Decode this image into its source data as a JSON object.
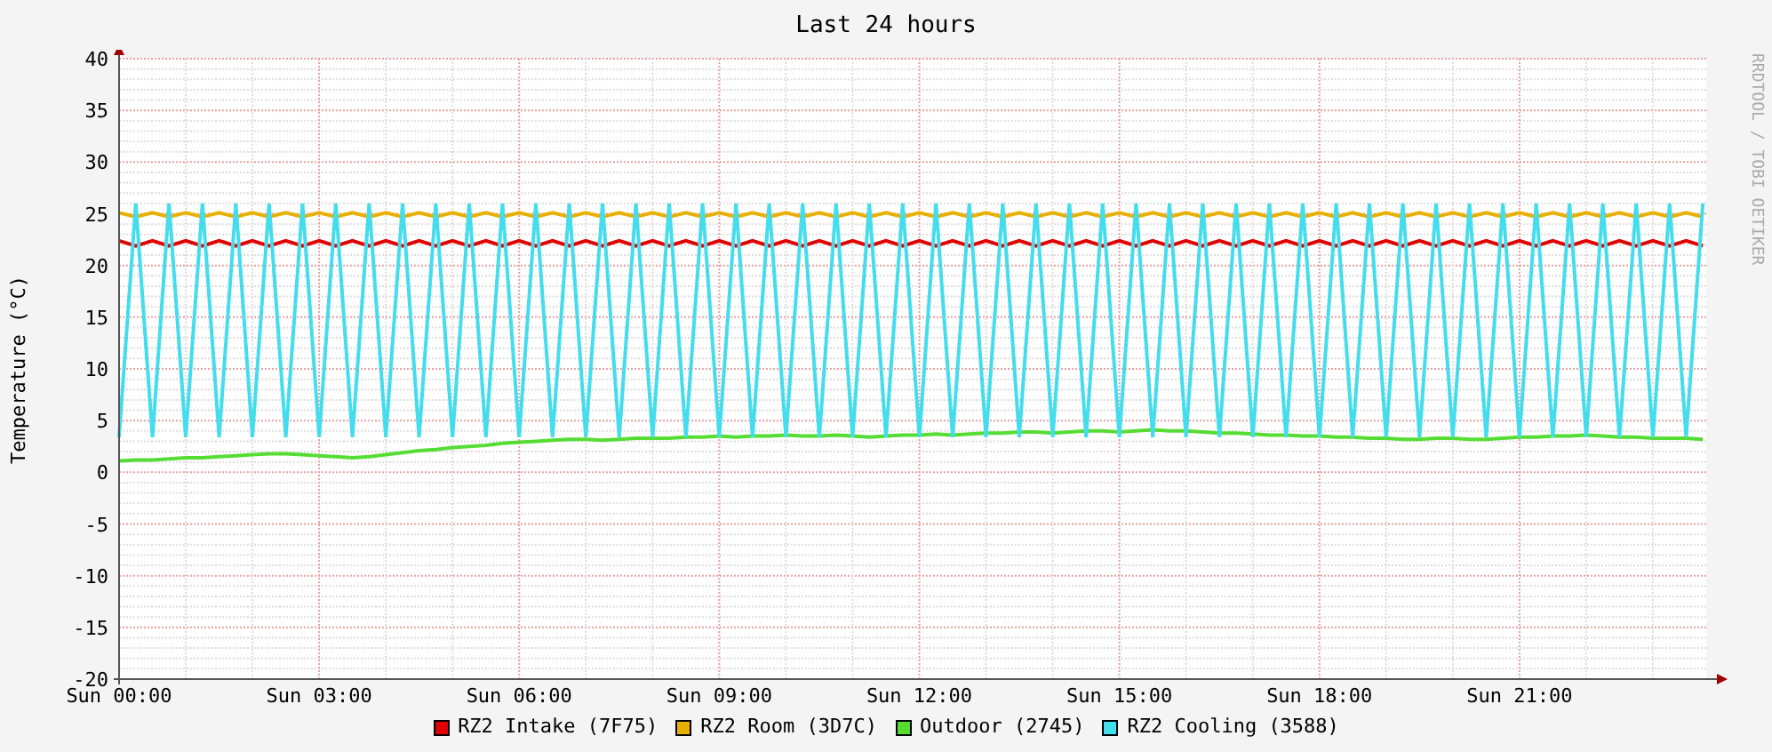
{
  "chart": {
    "chart_data": {
      "type": "line",
      "title": "Last 24 hours",
      "ylabel": "Temperature (°C)",
      "ylim": [
        -20,
        40
      ],
      "grid": true,
      "categories": [
        "Sun 00:00",
        null,
        null,
        null,
        null,
        null,
        null,
        null,
        null,
        null,
        null,
        null,
        "Sun 03:00",
        null,
        null,
        null,
        null,
        null,
        null,
        null,
        null,
        null,
        null,
        null,
        "Sun 06:00",
        null,
        null,
        null,
        null,
        null,
        null,
        null,
        null,
        null,
        null,
        null,
        "Sun 09:00",
        null,
        null,
        null,
        null,
        null,
        null,
        null,
        null,
        null,
        null,
        null,
        "Sun 12:00",
        null,
        null,
        null,
        null,
        null,
        null,
        null,
        null,
        null,
        null,
        null,
        "Sun 15:00",
        null,
        null,
        null,
        null,
        null,
        null,
        null,
        null,
        null,
        null,
        null,
        "Sun 18:00",
        null,
        null,
        null,
        null,
        null,
        null,
        null,
        null,
        null,
        null,
        null,
        "Sun 21:00",
        null,
        null,
        null,
        null,
        null,
        null,
        null,
        null,
        null,
        null,
        null
      ],
      "yticks": [
        -20,
        -15,
        -10,
        -5,
        0,
        5,
        10,
        15,
        20,
        25,
        30,
        35,
        40
      ],
      "series": [
        {
          "name": "RZ2 Intake (7F75)",
          "color": "#e00000",
          "values": [
            22.4,
            21.9,
            22.4,
            21.9,
            22.4,
            21.9,
            22.4,
            21.9,
            22.4,
            21.9,
            22.4,
            21.9,
            22.4,
            21.9,
            22.4,
            21.9,
            22.4,
            21.9,
            22.4,
            21.9,
            22.4,
            21.9,
            22.4,
            21.9,
            22.4,
            21.9,
            22.4,
            21.9,
            22.4,
            21.9,
            22.4,
            21.9,
            22.4,
            21.9,
            22.4,
            21.9,
            22.4,
            21.9,
            22.4,
            21.9,
            22.4,
            21.9,
            22.4,
            21.9,
            22.4,
            21.9,
            22.4,
            21.9,
            22.4,
            21.9,
            22.4,
            21.9,
            22.4,
            21.9,
            22.4,
            21.9,
            22.4,
            21.9,
            22.4,
            21.9,
            22.4,
            21.9,
            22.4,
            21.9,
            22.4,
            21.9,
            22.4,
            21.9,
            22.4,
            21.9,
            22.4,
            21.9,
            22.4,
            21.9,
            22.4,
            21.9,
            22.4,
            21.9,
            22.4,
            21.9,
            22.4,
            21.9,
            22.4,
            21.9,
            22.4,
            21.9,
            22.4,
            21.9,
            22.4,
            21.9,
            22.4,
            21.9,
            22.4,
            21.9,
            22.4,
            21.9
          ]
        },
        {
          "name": "RZ2 Room (3D7C)",
          "color": "#e8b000",
          "values": [
            25.1,
            24.7,
            25.1,
            24.7,
            25.1,
            24.7,
            25.1,
            24.7,
            25.1,
            24.7,
            25.1,
            24.7,
            25.1,
            24.7,
            25.1,
            24.7,
            25.1,
            24.7,
            25.1,
            24.7,
            25.1,
            24.7,
            25.1,
            24.7,
            25.1,
            24.7,
            25.1,
            24.7,
            25.1,
            24.7,
            25.1,
            24.7,
            25.1,
            24.7,
            25.1,
            24.7,
            25.1,
            24.7,
            25.1,
            24.7,
            25.1,
            24.7,
            25.1,
            24.7,
            25.1,
            24.7,
            25.1,
            24.7,
            25.1,
            24.7,
            25.1,
            24.7,
            25.1,
            24.7,
            25.1,
            24.7,
            25.1,
            24.7,
            25.1,
            24.7,
            25.1,
            24.7,
            25.1,
            24.7,
            25.1,
            24.7,
            25.1,
            24.7,
            25.1,
            24.7,
            25.1,
            24.7,
            25.1,
            24.7,
            25.1,
            24.7,
            25.1,
            24.7,
            25.1,
            24.7,
            25.1,
            24.7,
            25.1,
            24.7,
            25.1,
            24.7,
            25.1,
            24.7,
            25.1,
            24.7,
            25.1,
            24.7,
            25.1,
            24.7,
            25.1,
            24.7
          ]
        },
        {
          "name": "Outdoor (2745)",
          "color": "#55dd33",
          "values": [
            1.1,
            1.2,
            1.2,
            1.3,
            1.4,
            1.4,
            1.5,
            1.6,
            1.7,
            1.8,
            1.8,
            1.7,
            1.6,
            1.5,
            1.4,
            1.5,
            1.7,
            1.9,
            2.1,
            2.2,
            2.4,
            2.5,
            2.6,
            2.8,
            2.9,
            3.0,
            3.1,
            3.2,
            3.2,
            3.1,
            3.2,
            3.3,
            3.3,
            3.3,
            3.4,
            3.4,
            3.5,
            3.4,
            3.5,
            3.5,
            3.6,
            3.5,
            3.5,
            3.6,
            3.5,
            3.4,
            3.5,
            3.6,
            3.6,
            3.7,
            3.6,
            3.7,
            3.8,
            3.8,
            3.9,
            3.9,
            3.8,
            3.9,
            4.0,
            4.0,
            3.9,
            4.0,
            4.1,
            4.0,
            4.0,
            3.9,
            3.8,
            3.8,
            3.7,
            3.6,
            3.6,
            3.5,
            3.5,
            3.4,
            3.4,
            3.3,
            3.3,
            3.2,
            3.2,
            3.3,
            3.3,
            3.2,
            3.2,
            3.3,
            3.4,
            3.4,
            3.5,
            3.5,
            3.6,
            3.5,
            3.4,
            3.4,
            3.3,
            3.3,
            3.3,
            3.2
          ]
        },
        {
          "name": "RZ2 Cooling (3588)",
          "color": "#44dded",
          "values": [
            3.4,
            26,
            3.4,
            26,
            3.4,
            26,
            3.4,
            26,
            3.4,
            26,
            3.4,
            26,
            3.4,
            26,
            3.4,
            26,
            3.4,
            26,
            3.4,
            26,
            3.4,
            26,
            3.4,
            26,
            3.4,
            26,
            3.4,
            26,
            3.4,
            26,
            3.4,
            26,
            3.4,
            26,
            3.4,
            26,
            3.4,
            26,
            3.4,
            26,
            3.4,
            26,
            3.4,
            26,
            3.4,
            26,
            3.4,
            26,
            3.4,
            26,
            3.4,
            26,
            3.4,
            26,
            3.4,
            26,
            3.4,
            26,
            3.4,
            26,
            3.4,
            26,
            3.4,
            26,
            3.4,
            26,
            3.4,
            26,
            3.4,
            26,
            3.4,
            26,
            3.4,
            26,
            3.4,
            26,
            3.4,
            26,
            3.4,
            26,
            3.4,
            26,
            3.4,
            26,
            3.4,
            26,
            3.4,
            26,
            3.4,
            26,
            3.4,
            26,
            3.4,
            26,
            3.4,
            26
          ]
        }
      ]
    },
    "credit": "RRDTOOL / TOBI OETIKER"
  }
}
